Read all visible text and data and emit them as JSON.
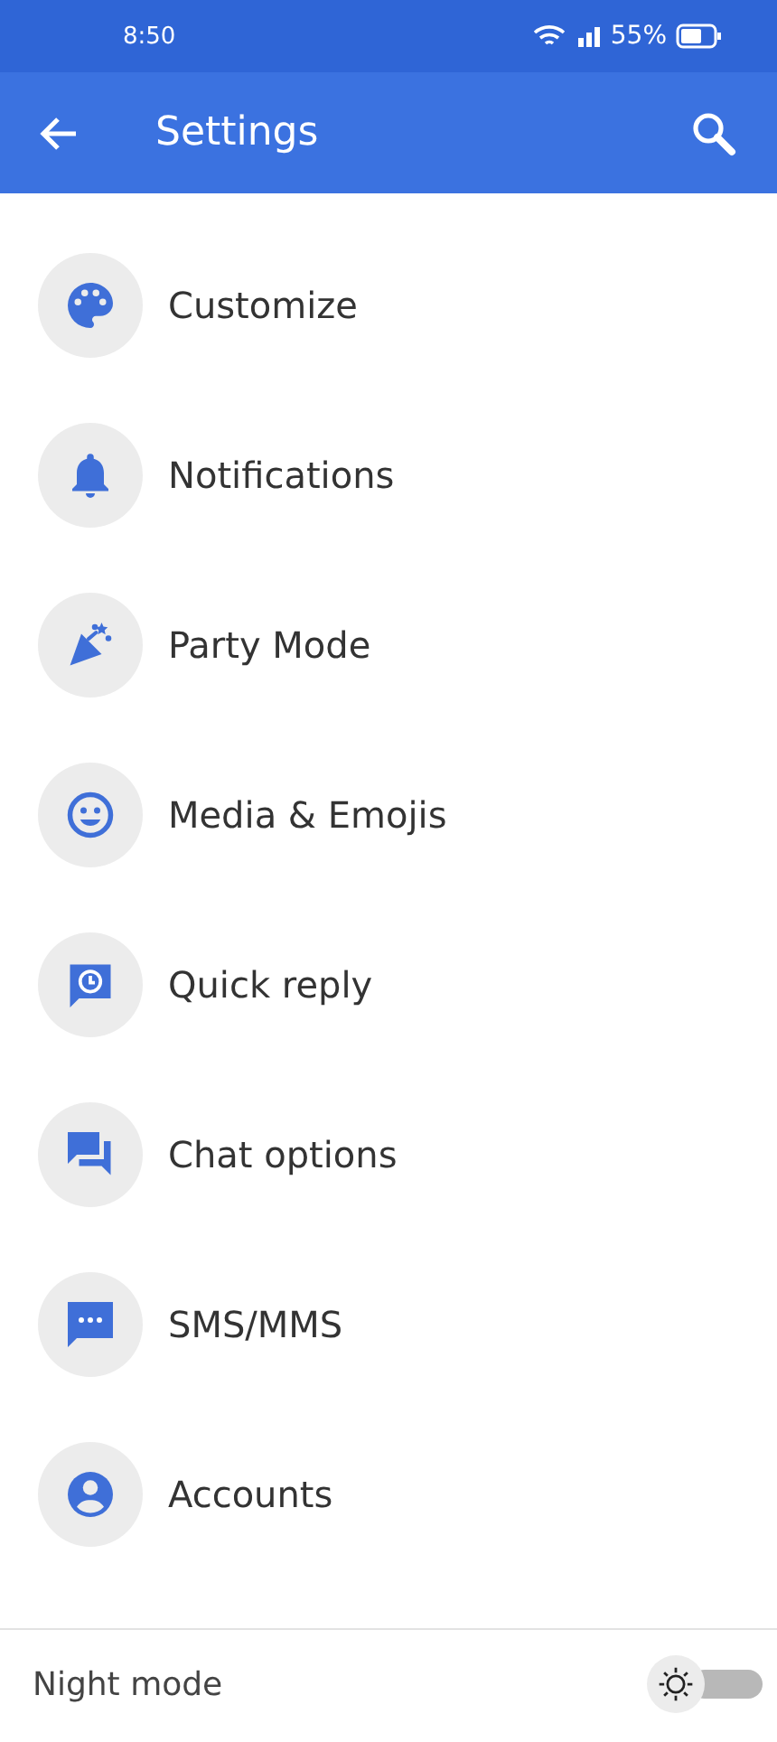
{
  "status_bar": {
    "time": "8:50",
    "battery": "55%"
  },
  "app_bar": {
    "title": "Settings"
  },
  "items": [
    {
      "label": "Customize",
      "kind": "palette"
    },
    {
      "label": "Notifications",
      "kind": "bell"
    },
    {
      "label": "Party Mode",
      "kind": "party"
    },
    {
      "label": "Media & Emojis",
      "kind": "smiley"
    },
    {
      "label": "Quick reply",
      "kind": "clock"
    },
    {
      "label": "Chat options",
      "kind": "chat"
    },
    {
      "label": "SMS/MMS",
      "kind": "sms"
    },
    {
      "label": "Accounts",
      "kind": "account"
    }
  ],
  "night_mode": {
    "label": "Night mode",
    "on": false
  }
}
